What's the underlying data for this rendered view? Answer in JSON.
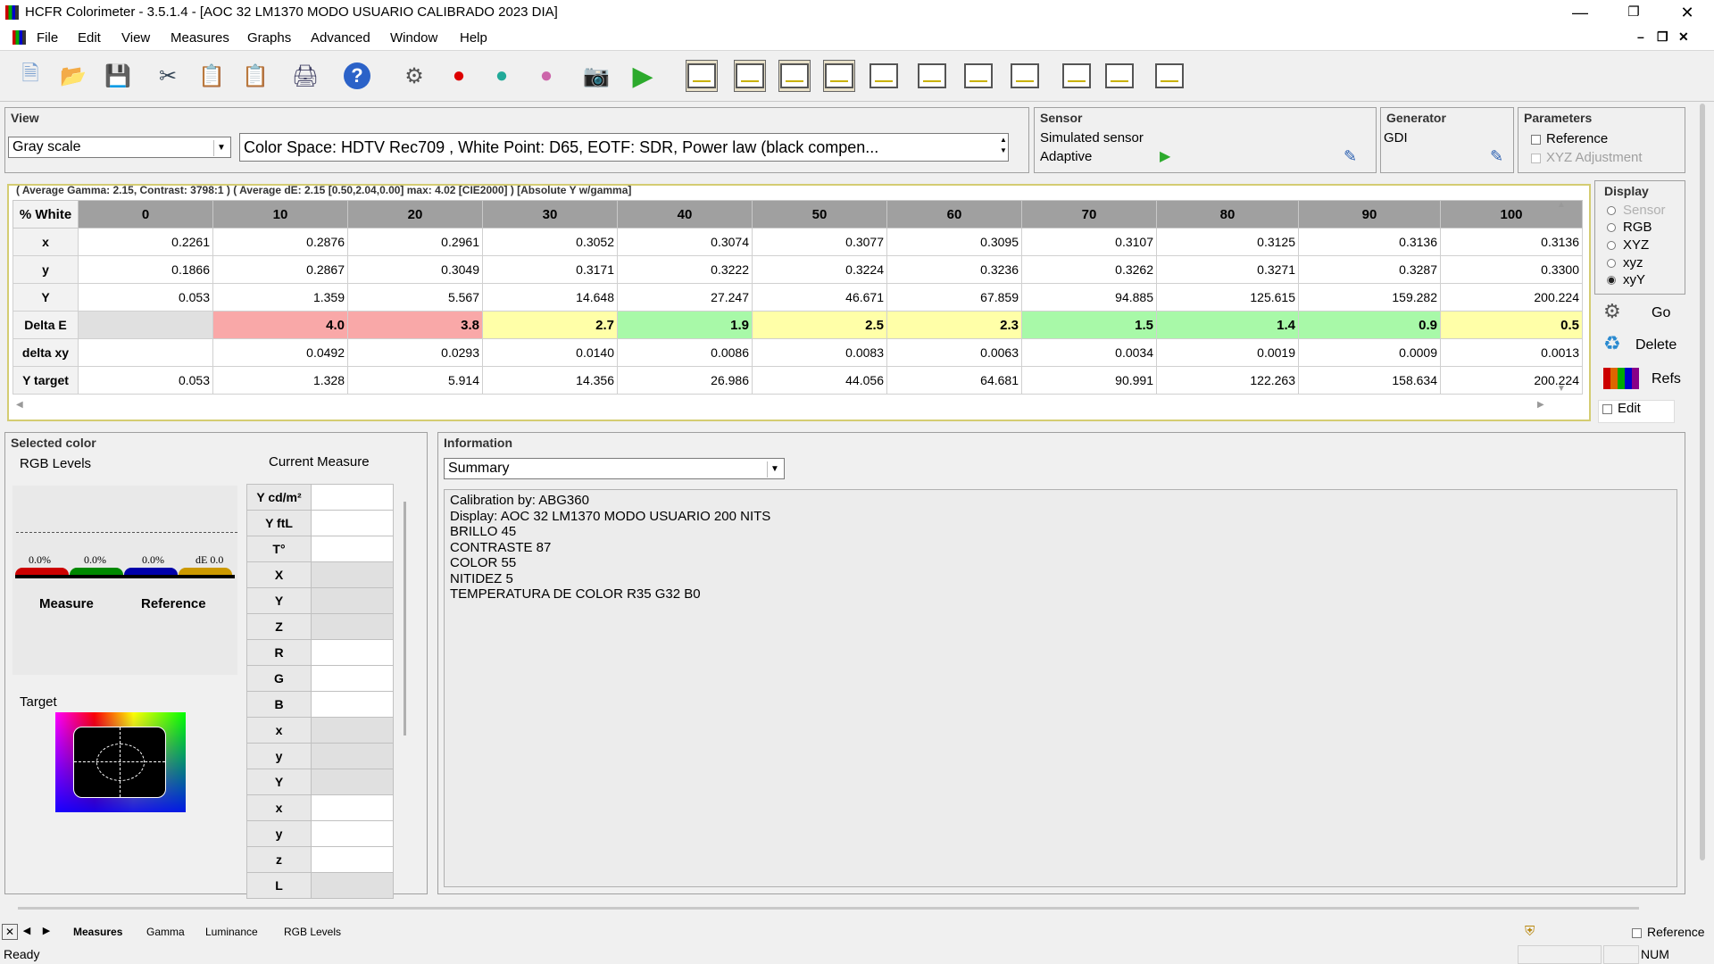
{
  "window": {
    "title": "HCFR Colorimeter - 3.5.1.4 - [AOC 32 LM1370 MODO USUARIO CALIBRADO 2023 DIA]"
  },
  "menu": [
    "File",
    "Edit",
    "View",
    "Measures",
    "Graphs",
    "Advanced",
    "Window",
    "Help"
  ],
  "view": {
    "title": "View",
    "selected": "Gray scale",
    "info": "Color Space: HDTV Rec709 , White Point: D65, EOTF:  SDR, Power law (black compen..."
  },
  "sensor": {
    "title": "Sensor",
    "name": "Simulated sensor",
    "mode": "Adaptive"
  },
  "generator": {
    "title": "Generator",
    "name": "GDI"
  },
  "parameters": {
    "title": "Parameters",
    "reference": "Reference",
    "xyz_adjustment": "XYZ Adjustment"
  },
  "summary_line": "( Average Gamma: 2.15, Contrast: 3798:1 ) ( Average dE: 2.15 [0.50,2.04,0.00] max: 4.02 [CIE2000] ) [Absolute Y w/gamma]",
  "grid": {
    "corner": "% White",
    "columns": [
      "0",
      "10",
      "20",
      "30",
      "40",
      "50",
      "60",
      "70",
      "80",
      "90",
      "100"
    ],
    "rows": [
      {
        "label": "x",
        "values": [
          "0.2261",
          "0.2876",
          "0.2961",
          "0.3052",
          "0.3074",
          "0.3077",
          "0.3095",
          "0.3107",
          "0.3125",
          "0.3136",
          "0.3136"
        ]
      },
      {
        "label": "y",
        "values": [
          "0.1866",
          "0.2867",
          "0.3049",
          "0.3171",
          "0.3222",
          "0.3224",
          "0.3236",
          "0.3262",
          "0.3271",
          "0.3287",
          "0.3300"
        ]
      },
      {
        "label": "Y",
        "values": [
          "0.053",
          "1.359",
          "5.567",
          "14.648",
          "27.247",
          "46.671",
          "67.859",
          "94.885",
          "125.615",
          "159.282",
          "200.224"
        ]
      },
      {
        "label": "Delta E",
        "values": [
          "",
          "4.0",
          "3.8",
          "2.7",
          "1.9",
          "2.5",
          "2.3",
          "1.5",
          "1.4",
          "0.9",
          "0.5"
        ]
      },
      {
        "label": "delta xy",
        "values": [
          "",
          "0.0492",
          "0.0293",
          "0.0140",
          "0.0086",
          "0.0083",
          "0.0063",
          "0.0034",
          "0.0019",
          "0.0009",
          "0.0013"
        ]
      },
      {
        "label": "Y target",
        "values": [
          "0.053",
          "1.328",
          "5.914",
          "14.356",
          "26.986",
          "44.056",
          "64.681",
          "90.991",
          "122.263",
          "158.634",
          "200.224"
        ]
      }
    ],
    "delta_e_colors": [
      "#e0e0e0",
      "#f9a8a8",
      "#f9a8a8",
      "#ffffa8",
      "#a8f9a8",
      "#ffffa8",
      "#ffffa8",
      "#a8f9a8",
      "#a8f9a8",
      "#a8f9a8",
      "#ffffa8"
    ]
  },
  "display": {
    "title": "Display",
    "options": [
      "Sensor",
      "RGB",
      "XYZ",
      "xyz",
      "xyY"
    ],
    "selected": "xyY"
  },
  "side_buttons": {
    "go": "Go",
    "delete": "Delete",
    "refs": "Refs",
    "edit": "Edit"
  },
  "selected_color": {
    "title": "Selected color",
    "rgb_levels": "RGB Levels",
    "current_measure": "Current Measure",
    "bars": [
      "0.0%",
      "0.0%",
      "0.0%",
      "dE 0.0"
    ],
    "measure": "Measure",
    "reference": "Reference",
    "target": "Target",
    "measure_labels": [
      "Y cd/m²",
      "Y ftL",
      "T°",
      "X",
      "Y",
      "Z",
      "R",
      "G",
      "B",
      "x",
      "y",
      "Y",
      "x",
      "y",
      "z",
      "L"
    ]
  },
  "information": {
    "title": "Information",
    "selected": "Summary",
    "text": "Calibration by: ABG360\nDisplay: AOC 32 LM1370 MODO USUARIO 200 NITS\nBRILLO 45\nCONTRASTE 87\nCOLOR 55\nNITIDEZ 5\nTEMPERATURA DE COLOR R35 G32 B0"
  },
  "tabs": [
    "Measures",
    "Gamma",
    "Luminance",
    "RGB Levels"
  ],
  "active_tab": "Measures",
  "status": {
    "text": "Ready",
    "num": "NUM",
    "reference": "Reference"
  }
}
